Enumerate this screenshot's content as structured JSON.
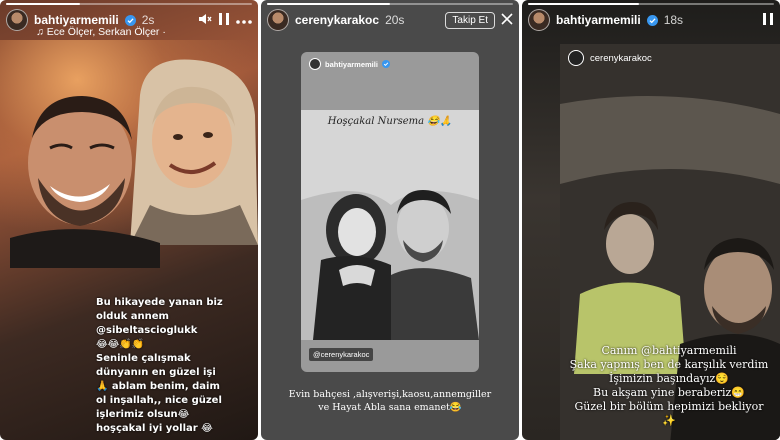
{
  "stories": [
    {
      "username": "bahtiyarmemili",
      "time": "2s",
      "music": "Ece Ölçer, Serkan Ölçer ·",
      "progress": 0.3,
      "controls": {
        "mute_icon": "mute-icon",
        "pause_icon": "pause-icon",
        "more_icon": "more-icon"
      },
      "caption_lines": [
        "Bu hikayede yanan biz",
        "olduk annem",
        "@sibeltascioglukk",
        "😂😂👏👏",
        "Seninle çalışmak",
        "dünyanın en güzel işi",
        "🙏 ablam benim, daim",
        "ol inşallah,, nice güzel",
        "işlerimiz olsun😂",
        "hoşçakal iyi yollar 😂"
      ]
    },
    {
      "username": "cerenykarakoc",
      "time": "20s",
      "follow_label": "Takip Et",
      "progress": 0.5,
      "card": {
        "username": "bahtiyarmemili",
        "title": "Hoşçakal Nursema 😂🙏",
        "tag": "@cerenykarakoc"
      },
      "caption_lines": [
        "Evin bahçesi ,alışverişi,kaosu,annemgiller",
        "ve Hayat Abla sana emanet😂"
      ]
    },
    {
      "username": "bahtiyarmemili",
      "time": "18s",
      "progress": 0.45,
      "card": {
        "username": "cerenykarakoc"
      },
      "caption_lines": [
        "Canım @bahtiyarmemili",
        "Şaka yapmış ben de karşılık verdim",
        "İşimizin başındayız😌",
        "Bu akşam yine beraberiz😁",
        "Güzel bir bölüm hepimizi bekliyor",
        "✨"
      ]
    }
  ]
}
